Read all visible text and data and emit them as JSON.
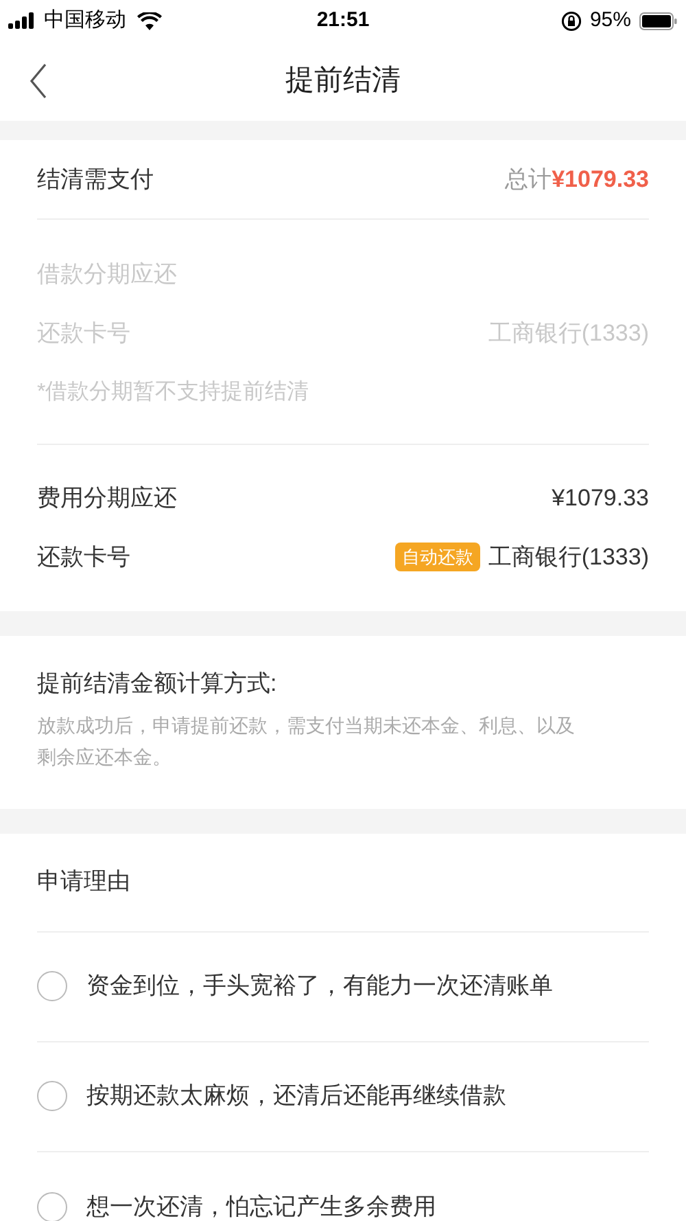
{
  "status_bar": {
    "carrier": "中国移动",
    "time": "21:51",
    "battery": "95%"
  },
  "nav": {
    "title": "提前结清"
  },
  "summary": {
    "label": "结清需支付",
    "total_prefix": "总计",
    "total": "¥1079.33"
  },
  "loan_section": {
    "disabled": true,
    "rows": [
      {
        "label": "借款分期应还"
      },
      {
        "label": "还款卡号",
        "value": "工商银行(1333)"
      }
    ],
    "note": "*借款分期暂不支持提前结清"
  },
  "fee_section": {
    "disabled": false,
    "rows": [
      {
        "label": "费用分期应还",
        "value": "¥1079.33"
      },
      {
        "label": "还款卡号",
        "badge": "自动还款",
        "value": "工商银行(1333)"
      }
    ]
  },
  "calculation": {
    "title": "提前结清金额计算方式:",
    "description": "放款成功后，申请提前还款，需支付当期未还本金、利息、以及剩余应还本金。"
  },
  "reasons": {
    "title": "申请理由",
    "options": [
      {
        "text": "资金到位，手头宽裕了，有能力一次还清账单",
        "selected": false
      },
      {
        "text": "按期还款太麻烦，还清后还能再继续借款",
        "selected": false
      },
      {
        "text": "想一次还清，怕忘记产生多余费用",
        "selected": false
      }
    ]
  }
}
